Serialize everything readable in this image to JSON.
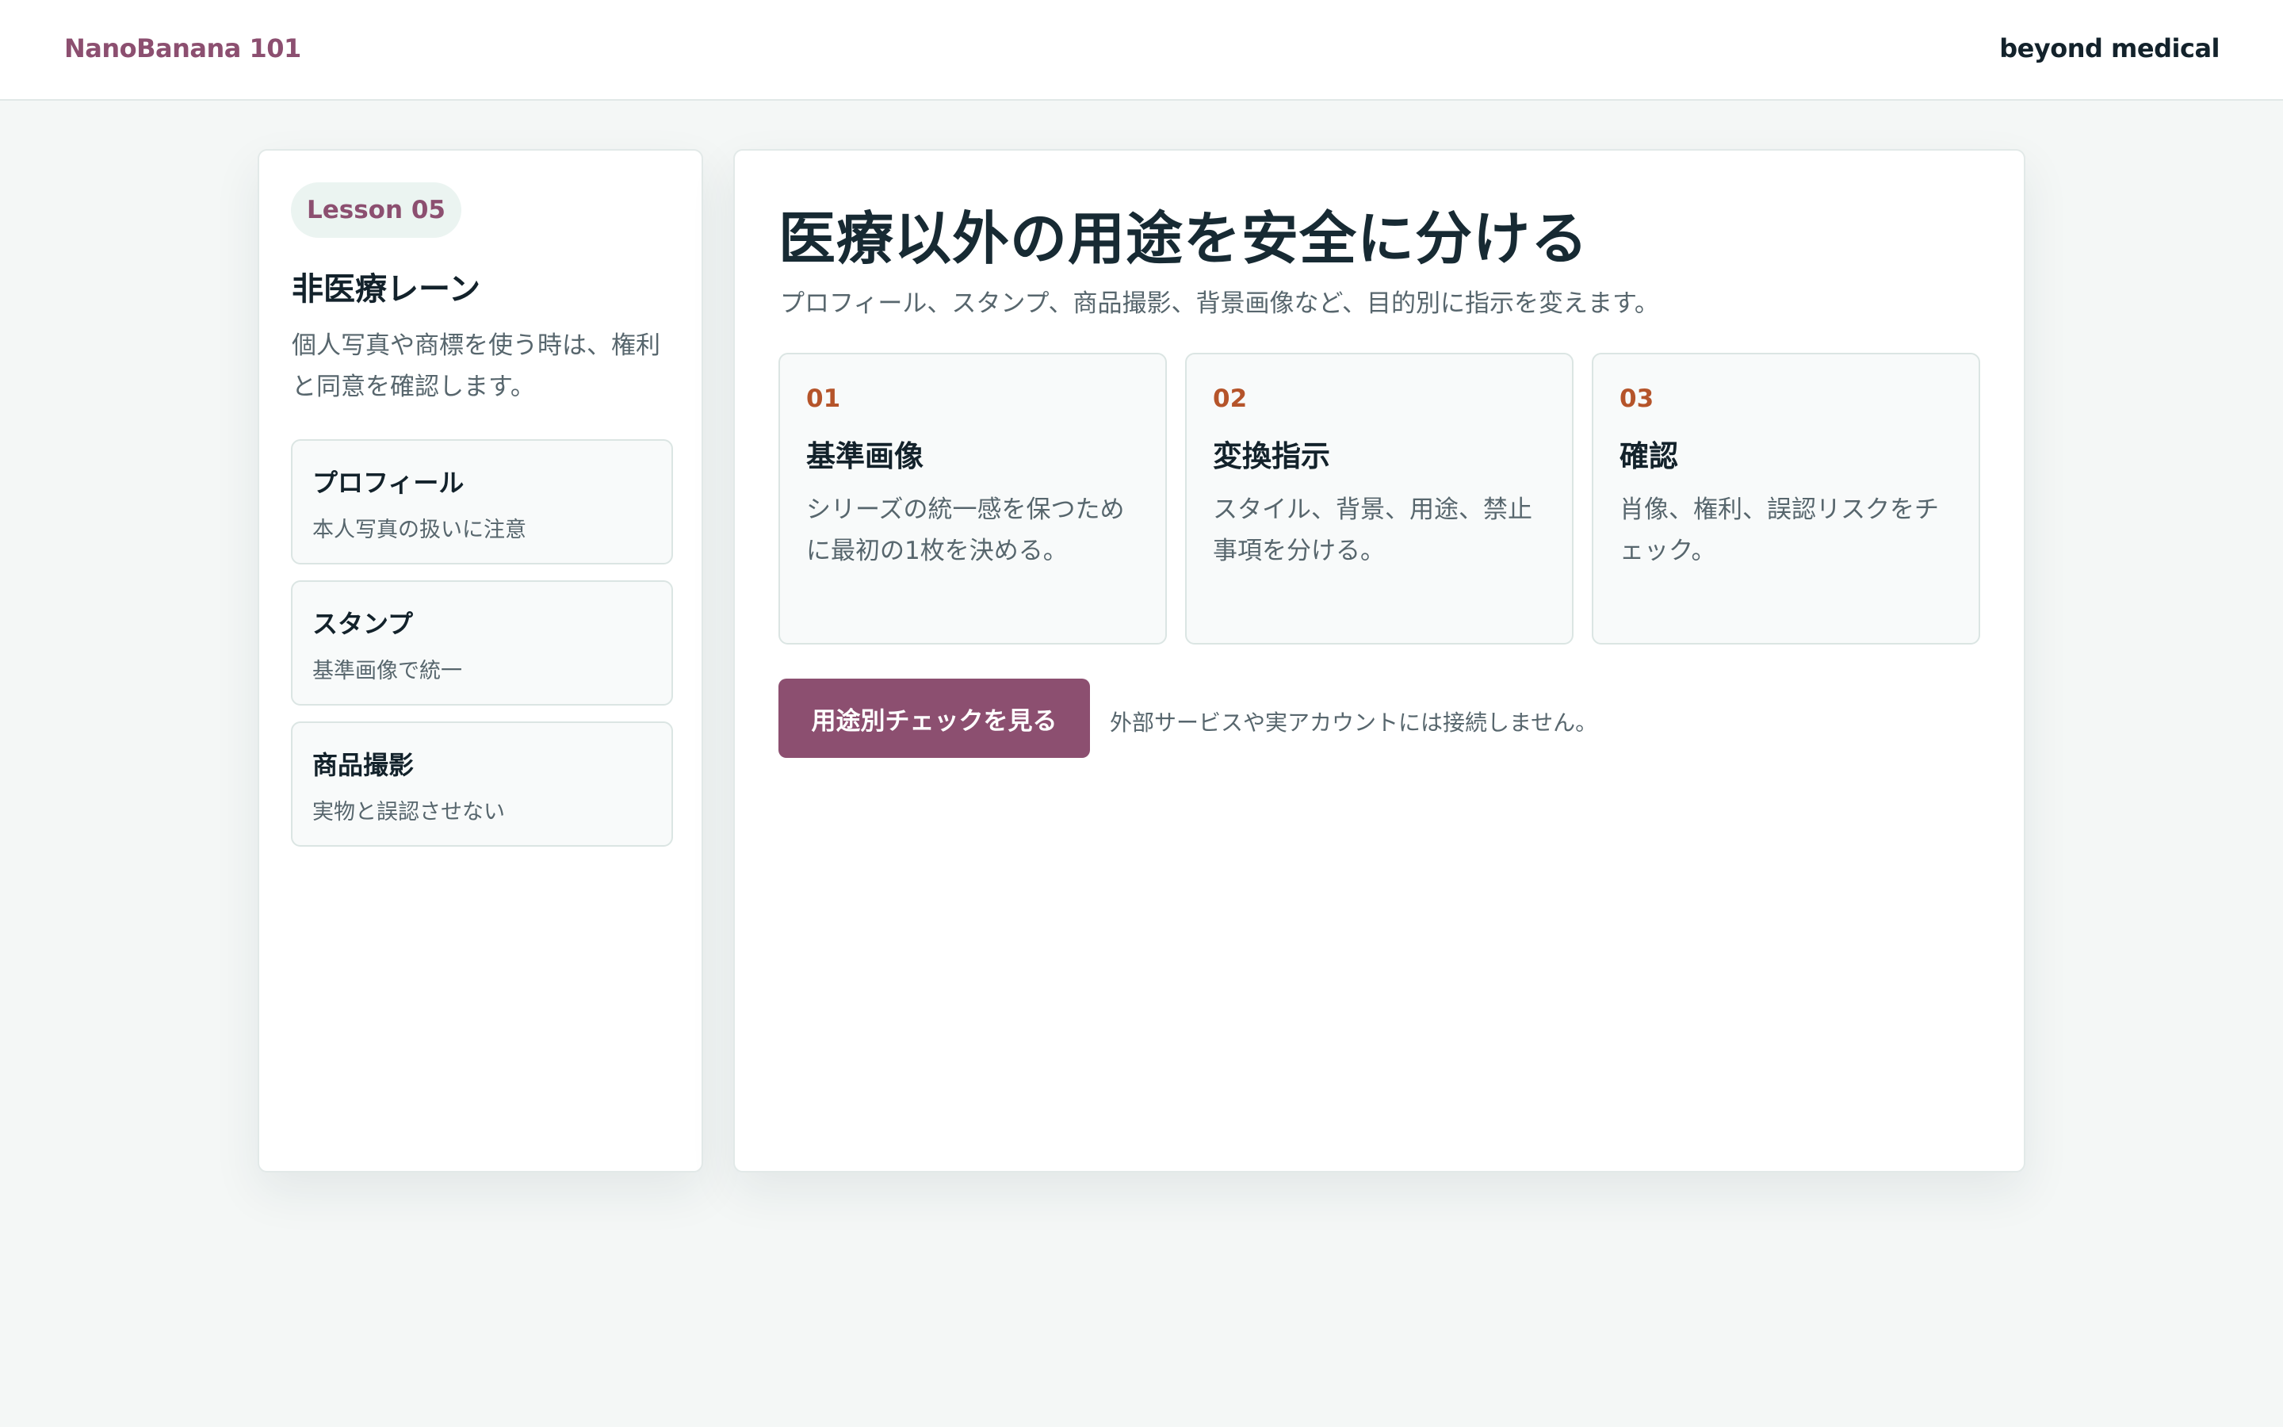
{
  "header": {
    "brand": "NanoBanana 101",
    "org": "beyond medical"
  },
  "sidebar": {
    "badge": "Lesson 05",
    "title": "非医療レーン",
    "description": "個人写真や商標を使う時は、権利と同意を確認します。",
    "items": [
      {
        "title": "プロフィール",
        "subtitle": "本人写真の扱いに注意"
      },
      {
        "title": "スタンプ",
        "subtitle": "基準画像で統一"
      },
      {
        "title": "商品撮影",
        "subtitle": "実物と誤認させない"
      }
    ]
  },
  "main": {
    "title": "医療以外の用途を安全に分ける",
    "subtitle": "プロフィール、スタンプ、商品撮影、背景画像など、目的別に指示を変えます。",
    "steps": [
      {
        "number": "01",
        "title": "基準画像",
        "description": "シリーズの統一感を保つために最初の1枚を決める。"
      },
      {
        "number": "02",
        "title": "変換指示",
        "description": "スタイル、背景、用途、禁止事項を分ける。"
      },
      {
        "number": "03",
        "title": "確認",
        "description": "肖像、権利、誤認リスクをチェック。"
      }
    ],
    "button_label": "用途別チェックを見る",
    "note": "外部サービスや実アカウントには接続しません。"
  },
  "colors": {
    "accent": "#8c4f70",
    "step_number": "#b5542a",
    "background": "#f4f7f6"
  }
}
